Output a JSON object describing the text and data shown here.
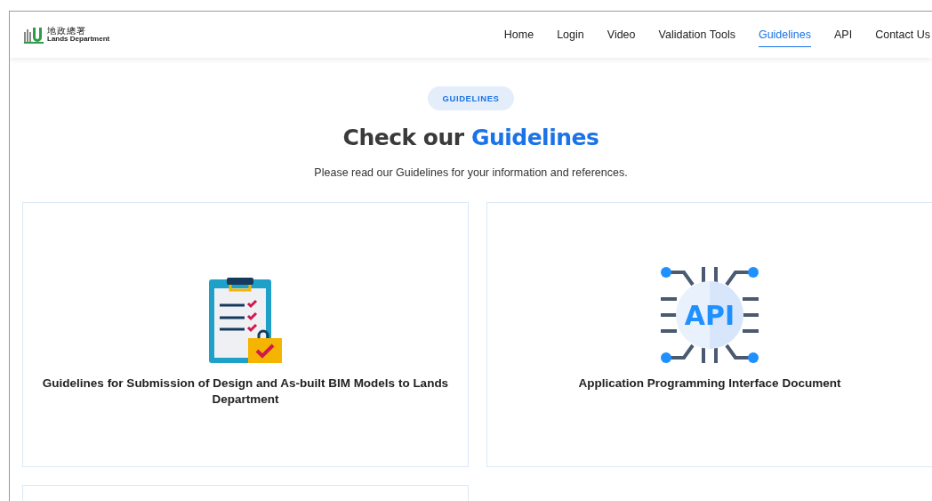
{
  "logo": {
    "chinese_name": "地政總署",
    "english_name": "Lands Department"
  },
  "nav": [
    {
      "label": "Home",
      "selected": false
    },
    {
      "label": "Login",
      "selected": false
    },
    {
      "label": "Video",
      "selected": false
    },
    {
      "label": "Validation Tools",
      "selected": false
    },
    {
      "label": "Guidelines",
      "selected": true
    },
    {
      "label": "API",
      "selected": false
    },
    {
      "label": "Contact Us",
      "selected": false
    }
  ],
  "section": {
    "badge": "GUIDELINES",
    "heading": "Check our **Guidelines**",
    "subtitle": "Please read our Guidelines for your information and references."
  },
  "cards": [
    {
      "kind": "clipboard",
      "title": "Guidelines for Submission of Design and As-built BIM Models to Lands Department"
    },
    {
      "kind": "api",
      "icon_text": "API",
      "title": "Application Programming Interface Document"
    },
    {
      "kind": "blank"
    }
  ]
}
